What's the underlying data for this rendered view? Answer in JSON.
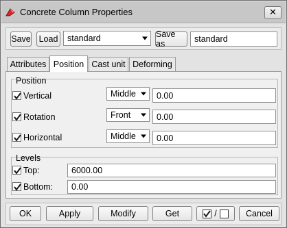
{
  "window": {
    "title": "Concrete Column Properties",
    "close_glyph": "✕"
  },
  "toolbar": {
    "save_label": "Save",
    "load_label": "Load",
    "preset_value": "standard",
    "save_as_label": "Save as",
    "save_as_value": "standard"
  },
  "tabs": [
    {
      "label": "Attributes",
      "active": false
    },
    {
      "label": "Position",
      "active": true
    },
    {
      "label": "Cast unit",
      "active": false
    },
    {
      "label": "Deforming",
      "active": false
    }
  ],
  "position_group": {
    "title": "Position",
    "rows": [
      {
        "label": "Vertical",
        "checked": true,
        "option": "Middle",
        "value": "0.00"
      },
      {
        "label": "Rotation",
        "checked": true,
        "option": "Front",
        "value": "0.00"
      },
      {
        "label": "Horizontal",
        "checked": true,
        "option": "Middle",
        "value": "0.00"
      }
    ]
  },
  "levels_group": {
    "title": "Levels",
    "rows": [
      {
        "label": "Top:",
        "checked": true,
        "value": "6000.00"
      },
      {
        "label": "Bottom:",
        "checked": true,
        "value": "0.00"
      }
    ]
  },
  "bottom_bar": {
    "ok_label": "OK",
    "apply_label": "Apply",
    "modify_label": "Modify",
    "get_label": "Get",
    "toggle_separator": "/",
    "cancel_label": "Cancel"
  },
  "colors": {
    "accent_icon": "#d8262a",
    "check_mark": "#1a1a1a"
  }
}
